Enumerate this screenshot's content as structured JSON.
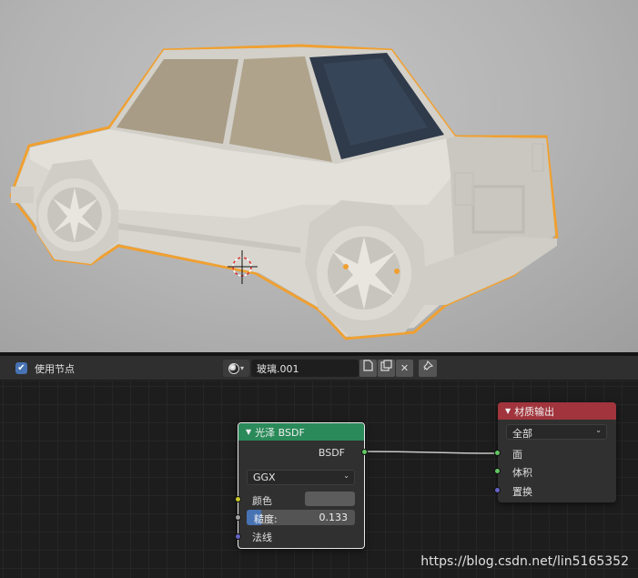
{
  "viewport": {
    "object": "car",
    "selection_outline_color": "#f0a030",
    "background_color": "#b7b7b7"
  },
  "header": {
    "use_nodes_checked": true,
    "use_nodes_label": "使用节点",
    "material_name": "玻璃.001",
    "icons": [
      "material-ball-icon",
      "browse-chevron-icon",
      "fake-user-icon",
      "duplicate-icon",
      "close-icon",
      "pin-icon"
    ]
  },
  "glossy_node": {
    "title": "光泽 BSDF",
    "output_label": "BSDF",
    "distribution": "GGX",
    "color_label": "颜色",
    "color_value": "#5c5c5c",
    "roughness_label": "糙度:",
    "roughness_value": "0.133",
    "roughness": 0.133,
    "normal_label": "法线"
  },
  "output_node": {
    "title": "材质输出",
    "target": "全部",
    "surface_label": "面",
    "volume_label": "体积",
    "displacement_label": "置换"
  },
  "colors": {
    "glossy_header": "#2b8a5a",
    "output_header": "#a1343c",
    "accent": "#4772b3"
  },
  "watermark": "https://blog.csdn.net/lin5165352"
}
